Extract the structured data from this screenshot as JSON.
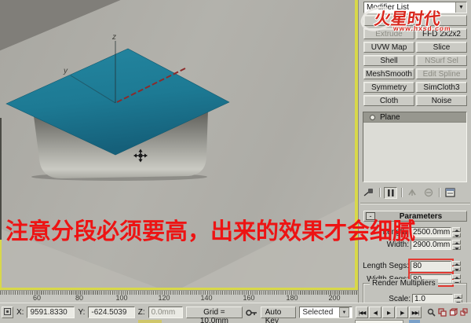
{
  "viewport": {
    "axis_labels": {
      "z": "z",
      "y": "y"
    },
    "annotation_text": "注意分段必须要高，出来的效果才会细腻",
    "colors": {
      "plane": "#1E7C96",
      "annotation": "#ED1414",
      "active_border": "#D8D84A"
    }
  },
  "watermark": {
    "title": "火星时代",
    "url": "www.hxsd.com"
  },
  "command_panel": {
    "modifier_list": {
      "label": "Modifier List"
    },
    "modifier_buttons": [
      {
        "label": "",
        "enabled": true
      },
      {
        "label": "",
        "enabled": true
      },
      {
        "label": "Extrude",
        "enabled": false
      },
      {
        "label": "FFD 2x2x2",
        "enabled": true
      },
      {
        "label": "UVW Map",
        "enabled": true
      },
      {
        "label": "Slice",
        "enabled": true
      },
      {
        "label": "Shell",
        "enabled": true
      },
      {
        "label": "NSurf Sel",
        "enabled": false
      },
      {
        "label": "MeshSmooth",
        "enabled": true
      },
      {
        "label": "Edit Spline",
        "enabled": false
      },
      {
        "label": "Symmetry",
        "enabled": true
      },
      {
        "label": "SimCloth3",
        "enabled": true
      },
      {
        "label": "Cloth",
        "enabled": true
      },
      {
        "label": "Noise",
        "enabled": true
      }
    ],
    "modifier_stack": {
      "items": [
        {
          "name": "Plane",
          "selected": true
        }
      ]
    },
    "parameters": {
      "title": "Parameters",
      "collapse_glyph": "-",
      "fields": [
        {
          "label": "Length:",
          "value": "2500.0mm"
        },
        {
          "label": "Width:",
          "value": "2900.0mm"
        },
        {
          "label": "Length Segs:",
          "value": "80"
        },
        {
          "label": "Width Segs:",
          "value": "80"
        }
      ],
      "render_multipliers": {
        "title": "Render Multipliers",
        "scale_label": "Scale:",
        "scale_value": "1.0"
      }
    }
  },
  "timeline": {
    "tick_labels": [
      "60",
      "80",
      "100",
      "120",
      "140",
      "160",
      "180",
      "200"
    ]
  },
  "status_bar": {
    "x_label": "X:",
    "x_value": "9591.8330",
    "y_label": "Y:",
    "y_value": "-624.5039",
    "z_label": "Z:",
    "z_value": "0.0mm",
    "grid_label": "Grid = 10.0mm",
    "auto_key_label": "Auto Key",
    "selection_filter_value": "Selected"
  }
}
